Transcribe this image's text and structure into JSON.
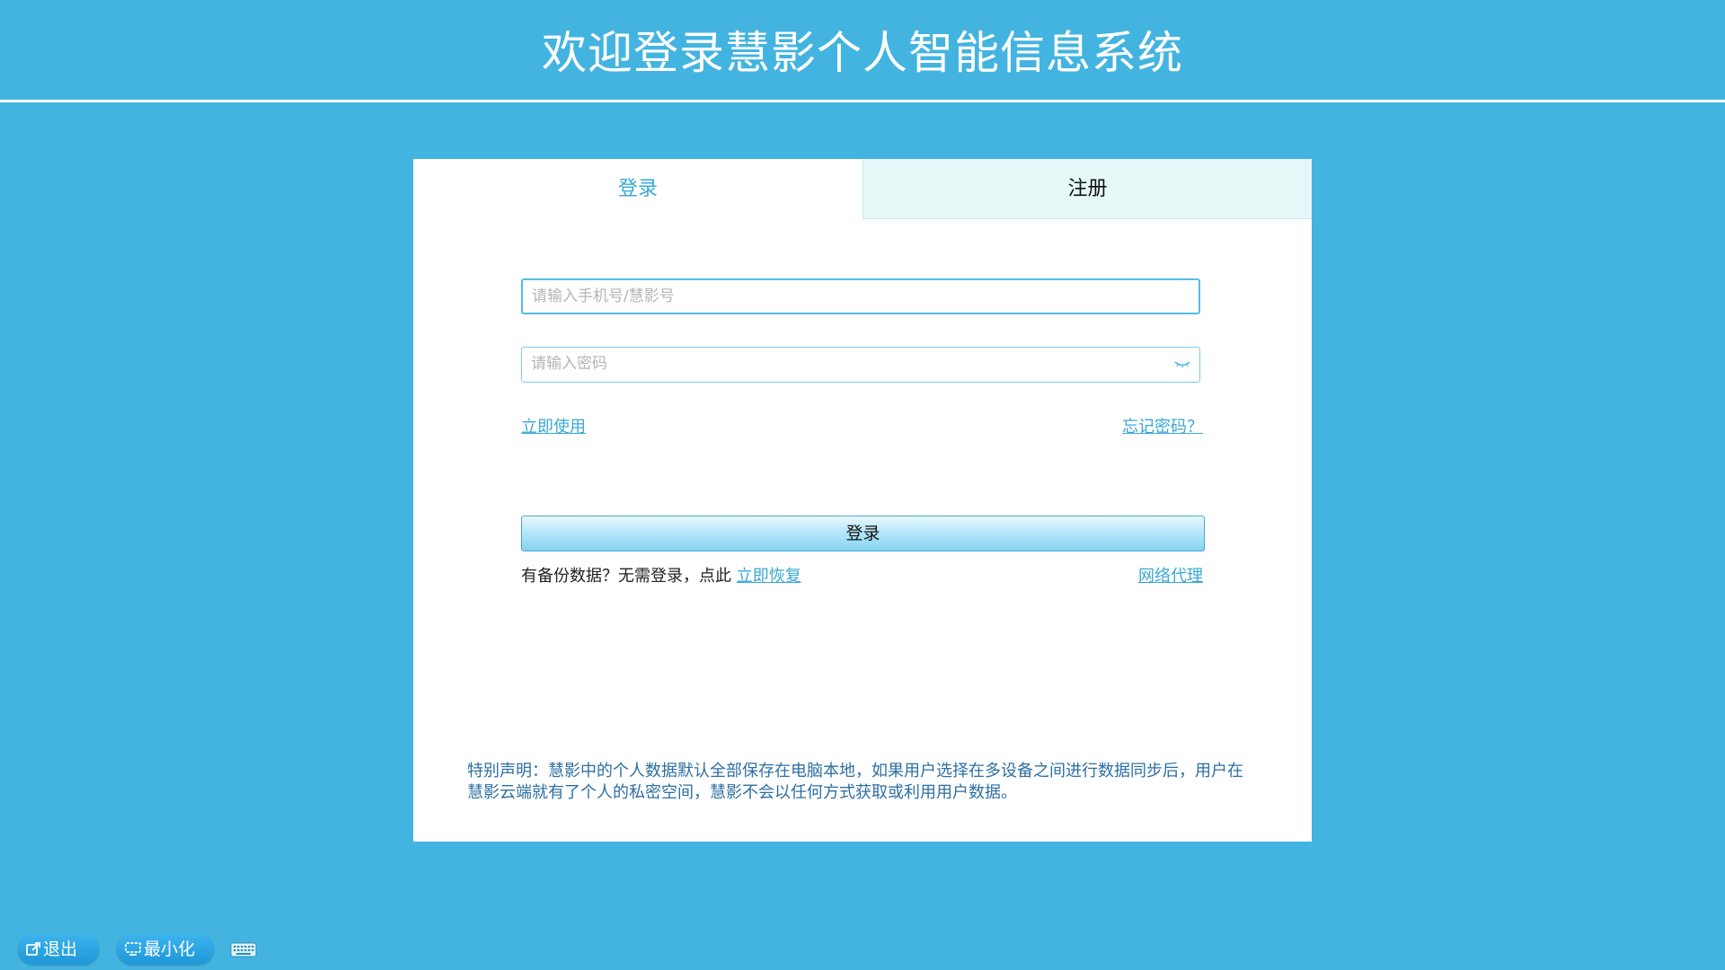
{
  "header": {
    "title": "欢迎登录慧影个人智能信息系统"
  },
  "tabs": {
    "login": "登录",
    "register": "注册",
    "active": "login"
  },
  "form": {
    "username_placeholder": "请输入手机号/慧影号",
    "username_value": "",
    "password_placeholder": "请输入密码",
    "password_value": "",
    "password_toggle_icon": "eye-closed-icon",
    "use_now_link": "立即使用",
    "forgot_link": "忘记密码？",
    "login_button": "登录",
    "backup_text": "有备份数据？无需登录，点此",
    "restore_link": "立即恢复",
    "proxy_link": "网络代理"
  },
  "notice": {
    "text": "特别声明：慧影中的个人数据默认全部保存在电脑本地，如果用户选择在多设备之间进行数据同步后，用户在慧影云端就有了个人的私密空间，慧影不会以任何方式获取或利用用户数据。"
  },
  "bottom_bar": {
    "exit_label": "退出",
    "minimize_label": "最小化",
    "exit_icon": "external-link-icon",
    "minimize_icon": "monitor-icon",
    "keyboard_icon": "keyboard-icon"
  },
  "colors": {
    "background": "#43b4e0",
    "accent": "#3aa8d6",
    "register_tab_bg": "#e5f7f7",
    "notice_text": "#2d6fa3"
  }
}
